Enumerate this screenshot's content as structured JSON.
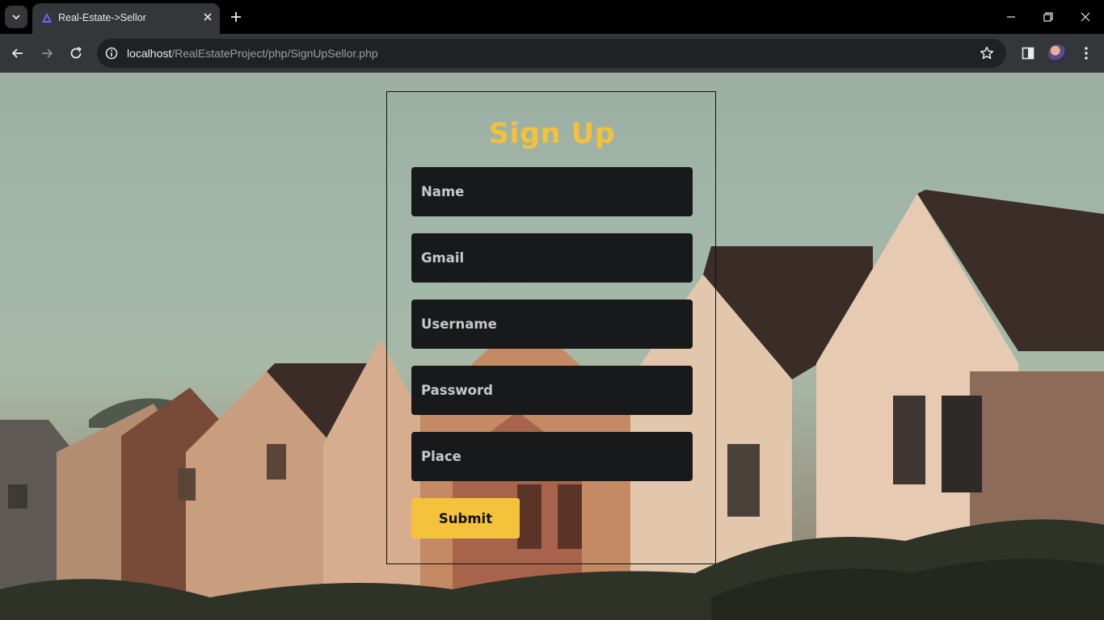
{
  "browser": {
    "tab": {
      "title": "Real-Estate->Sellor"
    },
    "address_bar": {
      "host": "localhost",
      "path": "/RealEstateProject/php/SignUpSellor.php"
    }
  },
  "form": {
    "title": "Sign Up",
    "fields": [
      {
        "placeholder": "Name"
      },
      {
        "placeholder": "Gmail"
      },
      {
        "placeholder": "Username"
      },
      {
        "placeholder": "Password"
      },
      {
        "placeholder": "Place"
      }
    ],
    "submit_label": "Submit"
  },
  "colors": {
    "accent": "#f5c33b",
    "field_background": "#18191b",
    "chrome_toolbar": "#35363a"
  }
}
